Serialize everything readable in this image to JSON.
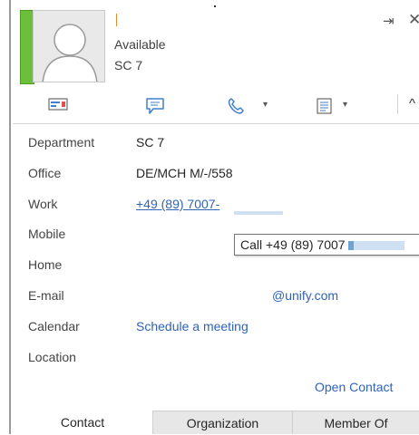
{
  "header": {
    "status": "Available",
    "department": "SC 7",
    "pin_icon": "pin-icon",
    "close_icon": "close-icon"
  },
  "toolbar": {
    "icons": [
      "instant-message-icon",
      "chat-icon",
      "phone-icon",
      "calendar-list-icon",
      "collapse-icon"
    ],
    "pin_glyph": "⇥",
    "close_glyph": "✕",
    "caret": "▾",
    "collapse_glyph": "^"
  },
  "details": {
    "department_label": "Department",
    "department_value": "SC 7",
    "office_label": "Office",
    "office_value": "DE/MCH M/-/558",
    "work_label": "Work",
    "work_value": "+49 (89) 7007-",
    "mobile_label": "Mobile",
    "home_label": "Home",
    "email_label": "E-mail",
    "email_value": "@unify.com",
    "calendar_label": "Calendar",
    "calendar_value": "Schedule a meeting",
    "location_label": "Location"
  },
  "tooltip": {
    "text": "Call +49 (89) 7007"
  },
  "open_contact": "Open Contact",
  "tabs": [
    "Contact",
    "Organization",
    "Member Of"
  ],
  "colors": {
    "presence": "#6cbf3a",
    "link": "#2f63b5",
    "icon": "#5b86bd"
  }
}
